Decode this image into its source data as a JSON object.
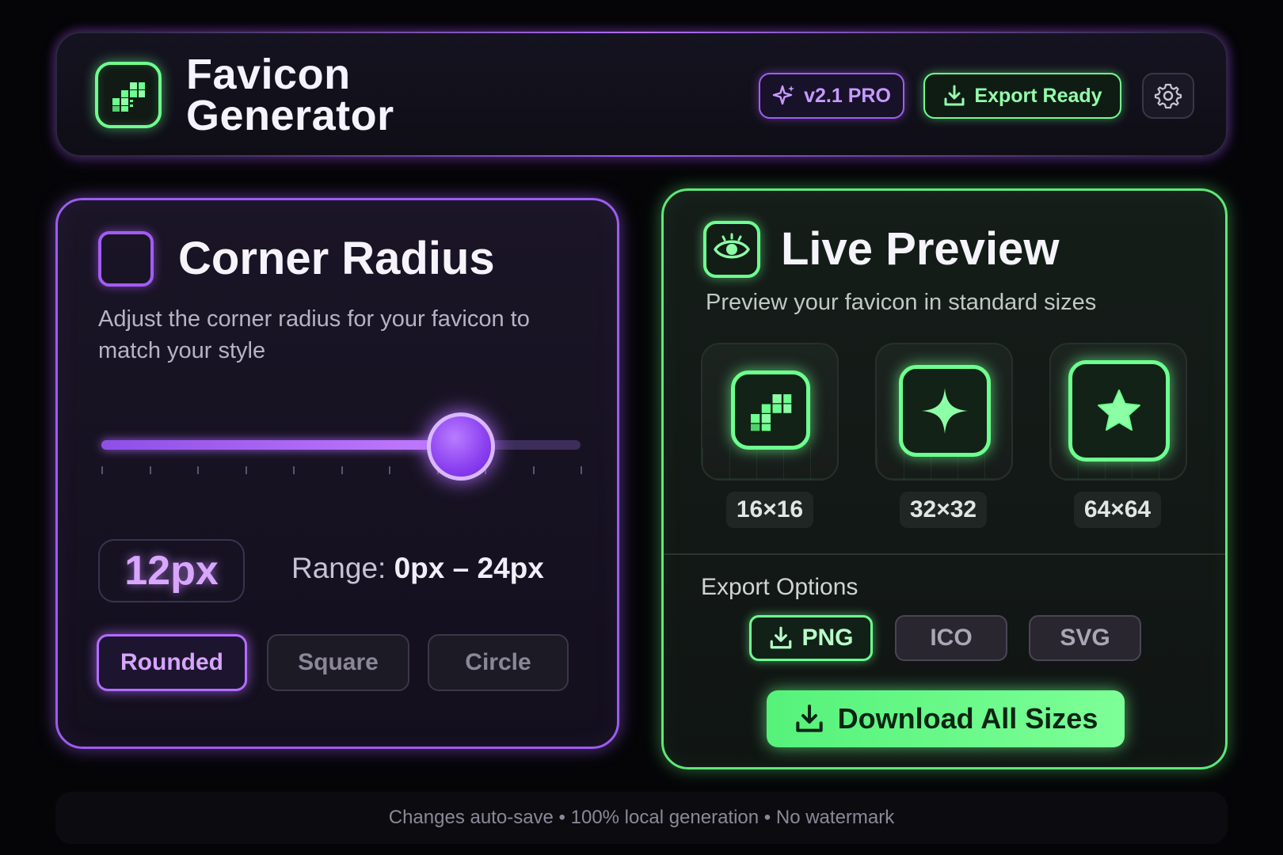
{
  "header": {
    "title_line1": "Favicon",
    "title_line2": "Generator",
    "version_badge": "v2.1 PRO",
    "export_badge": "Export Ready",
    "logo_icon": "pixel-grid-icon",
    "settings_icon": "gear-icon"
  },
  "corner_radius": {
    "title": "Corner Radius",
    "description": "Adjust the corner radius for your favicon to match your style",
    "value": "12px",
    "slider_value": 18,
    "slider_min": 0,
    "slider_max": 24,
    "range_prefix": "Range: ",
    "range_values": "0px – 24px",
    "shapes": [
      "Rounded",
      "Square",
      "Circle"
    ],
    "selected_shape": "Rounded"
  },
  "live_preview": {
    "title": "Live Preview",
    "subtitle": "Preview your favicon in standard sizes",
    "sizes": [
      "16×16",
      "32×32",
      "64×64"
    ],
    "export_title": "Export Options",
    "formats": [
      "PNG",
      "ICO",
      "SVG"
    ],
    "selected_format": "PNG",
    "download_label": "Download All Sizes"
  },
  "footer": {
    "text": "Changes auto-save • 100% local generation • No watermark"
  },
  "colors": {
    "accent_purple": "#a35cf5",
    "accent_green": "#6dff8f",
    "background": "#050507"
  }
}
